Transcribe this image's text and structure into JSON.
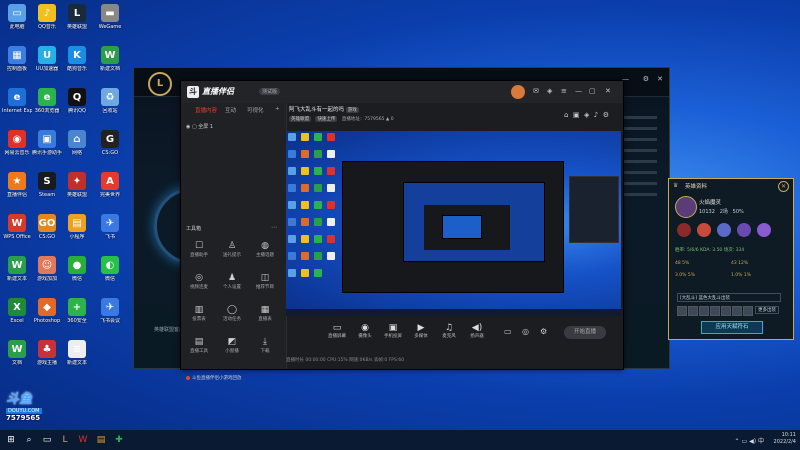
{
  "desktop_icons": [
    {
      "label": "此电脑",
      "color": "#5aa0e6",
      "glyph": "▭"
    },
    {
      "label": "QQ音乐",
      "color": "#f0c020",
      "glyph": "♪"
    },
    {
      "label": "英雄联盟",
      "color": "#1a2a3a",
      "glyph": "L"
    },
    {
      "label": "WeGame",
      "color": "#888",
      "glyph": "▬"
    },
    {
      "label": "控制面板",
      "color": "#3b7de0",
      "glyph": "▦"
    },
    {
      "label": "UU加速器",
      "color": "#27b0e8",
      "glyph": "U"
    },
    {
      "label": "酷狗音乐",
      "color": "#1a8de6",
      "glyph": "K"
    },
    {
      "label": "新建文档",
      "color": "#2a9e4a",
      "glyph": "W"
    },
    {
      "label": "Internet Explorer",
      "color": "#1e6fd6",
      "glyph": "e"
    },
    {
      "label": "360浏览器",
      "color": "#2bb24c",
      "glyph": "e"
    },
    {
      "label": "腾讯QQ",
      "color": "#111",
      "glyph": "Q"
    },
    {
      "label": "回收站",
      "color": "#6fa8e0",
      "glyph": "♻"
    },
    {
      "label": "网易云音乐",
      "color": "#e0302a",
      "glyph": "◉"
    },
    {
      "label": "腾讯手游助手",
      "color": "#3a7ad8",
      "glyph": "▣"
    },
    {
      "label": "网络",
      "color": "#4a86d0",
      "glyph": "⌂"
    },
    {
      "label": "CS:GO",
      "color": "#222",
      "glyph": "G"
    },
    {
      "label": "直播伴侣",
      "color": "#f07a1a",
      "glyph": "★"
    },
    {
      "label": "Steam",
      "color": "#171a21",
      "glyph": "S"
    },
    {
      "label": "英雄联盟",
      "color": "#c0302a",
      "glyph": "✦"
    },
    {
      "label": "完美世界",
      "color": "#e63a2a",
      "glyph": "A"
    },
    {
      "label": "WPS Office",
      "color": "#d63a2a",
      "glyph": "W"
    },
    {
      "label": "CS:GO",
      "color": "#e58a1a",
      "glyph": "GO"
    },
    {
      "label": "小程序",
      "color": "#f0a020",
      "glyph": "▤"
    },
    {
      "label": "飞书",
      "color": "#3a7ae0",
      "glyph": "✈"
    },
    {
      "label": "新建文本",
      "color": "#2a9e4a",
      "glyph": "W"
    },
    {
      "label": "游戏加加",
      "color": "#e07a5a",
      "glyph": "☺"
    },
    {
      "label": "微信",
      "color": "#2aae3a",
      "glyph": "●"
    },
    {
      "label": "微信",
      "color": "#27c14a",
      "glyph": "◐"
    },
    {
      "label": "Excel",
      "color": "#1f8a3a",
      "glyph": "X"
    },
    {
      "label": "Photoshop",
      "color": "#e06a2a",
      "glyph": "◆"
    },
    {
      "label": "360安全",
      "color": "#2cb34a",
      "glyph": "+"
    },
    {
      "label": "飞书会议",
      "color": "#3a7ae0",
      "glyph": "✈"
    },
    {
      "label": "文档",
      "color": "#2a9e4a",
      "glyph": "W"
    },
    {
      "label": "游戏主播",
      "color": "#c8303a",
      "glyph": "♣"
    },
    {
      "label": "新建文本",
      "color": "#eee",
      "glyph": "≡"
    }
  ],
  "watermark": {
    "logo": "斗鱼",
    "sub": "DOUYU.COM",
    "id": "7579565"
  },
  "app": {
    "name": "直播伴侣",
    "version": "测试版",
    "tabs": [
      "直播内容",
      "互动",
      "可视化"
    ],
    "scene": "全屏 1",
    "tools_title": "工具箱",
    "tools": [
      {
        "icon": "☐",
        "label": "直播助手"
      },
      {
        "icon": "♙",
        "label": "送礼提示"
      },
      {
        "icon": "◍",
        "label": "主播话题"
      },
      {
        "icon": "◎",
        "label": "视频连麦"
      },
      {
        "icon": "♟",
        "label": "个人设置"
      },
      {
        "icon": "◫",
        "label": "推荐节目"
      },
      {
        "icon": "▥",
        "label": "投票表"
      },
      {
        "icon": "◯",
        "label": "活动任务"
      },
      {
        "icon": "▦",
        "label": "直播表"
      },
      {
        "icon": "▤",
        "label": "直播工具"
      },
      {
        "icon": "◩",
        "label": "小窗播"
      },
      {
        "icon": "⤓",
        "label": "下载"
      }
    ],
    "promo": "斗鱼直播伴侣小游戏回放",
    "room_title": "阿飞大乱斗有一起的吗",
    "room_tag": "游戏",
    "room_cat1": "英雄联盟",
    "room_cat2": "快速上传",
    "room_link": "直播地址：7579565",
    "room_count": "0",
    "bottom_buttons": [
      {
        "icon": "▭",
        "label": "直播屏幕"
      },
      {
        "icon": "◉",
        "label": "摄像头"
      },
      {
        "icon": "▣",
        "label": "手机投屏"
      },
      {
        "icon": "▶",
        "label": "多媒体"
      },
      {
        "icon": "♫",
        "label": "麦克风"
      },
      {
        "icon": "◀)",
        "label": "扬声器"
      }
    ],
    "start_live": "开始直播",
    "status": "直播时长 00:00:00   CPU:15%   网速:0KB/s   丢帧:0   FPS:60"
  },
  "assist": {
    "title": "英雄资料",
    "player_name": "火焰魔灵",
    "stats": [
      "10132",
      "2场",
      "50%"
    ],
    "rates": "胜率: 5/6/6   KDA: 3.50   场次: 334",
    "grid": [
      "48   5%",
      "43   12%",
      "3.0% 5%",
      "1.0% 1%"
    ],
    "select": "[大乱斗] 蓝色大乱斗出装",
    "more": "更多出装",
    "apply_button": "应用天赋符石"
  },
  "lol": {
    "bottom_text": "英雄联盟客户端"
  },
  "taskbar": {
    "icons": [
      "⊞",
      "⌕",
      "▭",
      "L",
      "W",
      "▤",
      "✚"
    ],
    "time": "10:11",
    "date": "2022/2/4"
  }
}
